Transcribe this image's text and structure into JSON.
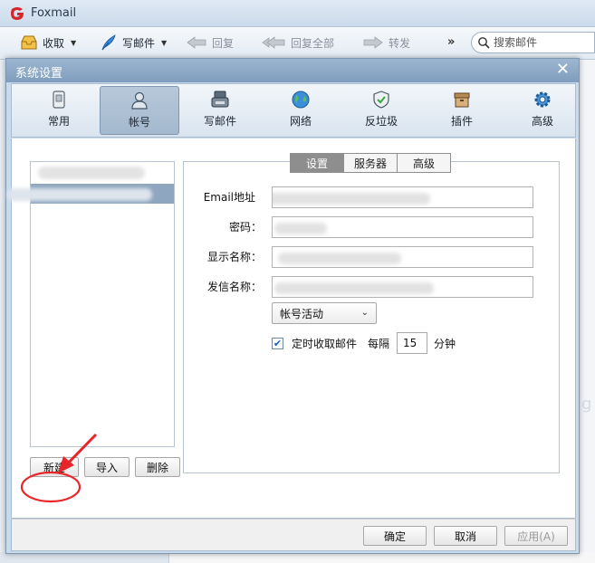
{
  "app": {
    "title": "Foxmail"
  },
  "toolbar": {
    "receive": "收取",
    "compose": "写邮件",
    "reply": "回复",
    "reply_all": "回复全部",
    "forward": "转发",
    "more": "»",
    "search_placeholder": "搜索邮件"
  },
  "dialog": {
    "title": "系统设置",
    "close": "✕",
    "categories": [
      {
        "label": "常用",
        "icon": "general-icon"
      },
      {
        "label": "帐号",
        "icon": "account-icon"
      },
      {
        "label": "写邮件",
        "icon": "compose-icon"
      },
      {
        "label": "网络",
        "icon": "network-icon"
      },
      {
        "label": "反垃圾",
        "icon": "antispam-icon"
      },
      {
        "label": "插件",
        "icon": "plugin-icon"
      },
      {
        "label": "高级",
        "icon": "advanced-icon"
      }
    ],
    "active_category": "帐号",
    "account_buttons": {
      "new": "新建",
      "import": "导入",
      "delete": "删除"
    },
    "sub_tabs": [
      "设置",
      "服务器",
      "高级"
    ],
    "active_sub_tab": "设置",
    "fields": {
      "email_label": "Email地址",
      "password_label": "密码：",
      "display_name_label": "显示名称：",
      "sender_name_label": "发信名称："
    },
    "status_select": "帐号活动",
    "auto_fetch": {
      "checked": true,
      "label": "定时收取邮件",
      "every": "每隔",
      "interval": "15",
      "unit": "分钟"
    },
    "footer": {
      "ok": "确定",
      "cancel": "取消",
      "apply": "应用(A)"
    }
  },
  "colors": {
    "annotation": "#e8262a",
    "selected_row": "#8ea6bf",
    "dialog_title": "#8aa7c6"
  }
}
